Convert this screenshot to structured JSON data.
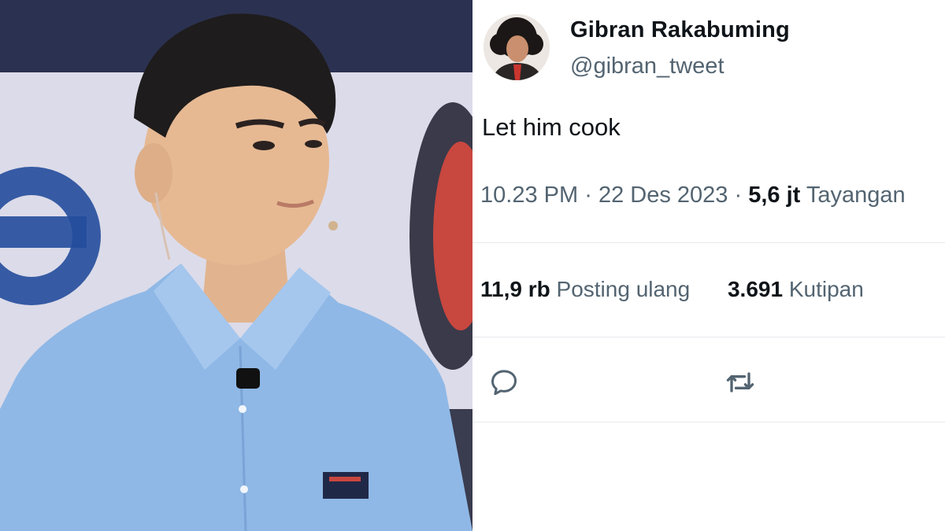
{
  "photo": {
    "description_icon": "person-photo"
  },
  "tweet": {
    "display_name": "Gibran Rakabuming",
    "handle": "@gibran_tweet",
    "text": "Let him cook",
    "time": "10.23 PM",
    "date": "22 Des 2023",
    "separator": "·",
    "views_count": "5,6 jt",
    "views_label": "Tayangan",
    "reposts_count": "11,9 rb",
    "reposts_label": "Posting ulang",
    "quotes_count": "3.691",
    "quotes_label": "Kutipan"
  },
  "icons": {
    "reply": "reply-icon",
    "repost": "repost-icon"
  },
  "colors": {
    "text_primary": "#0f1419",
    "text_secondary": "#536471",
    "divider": "#e7e9ec",
    "shirt": "#8fb8e6"
  }
}
